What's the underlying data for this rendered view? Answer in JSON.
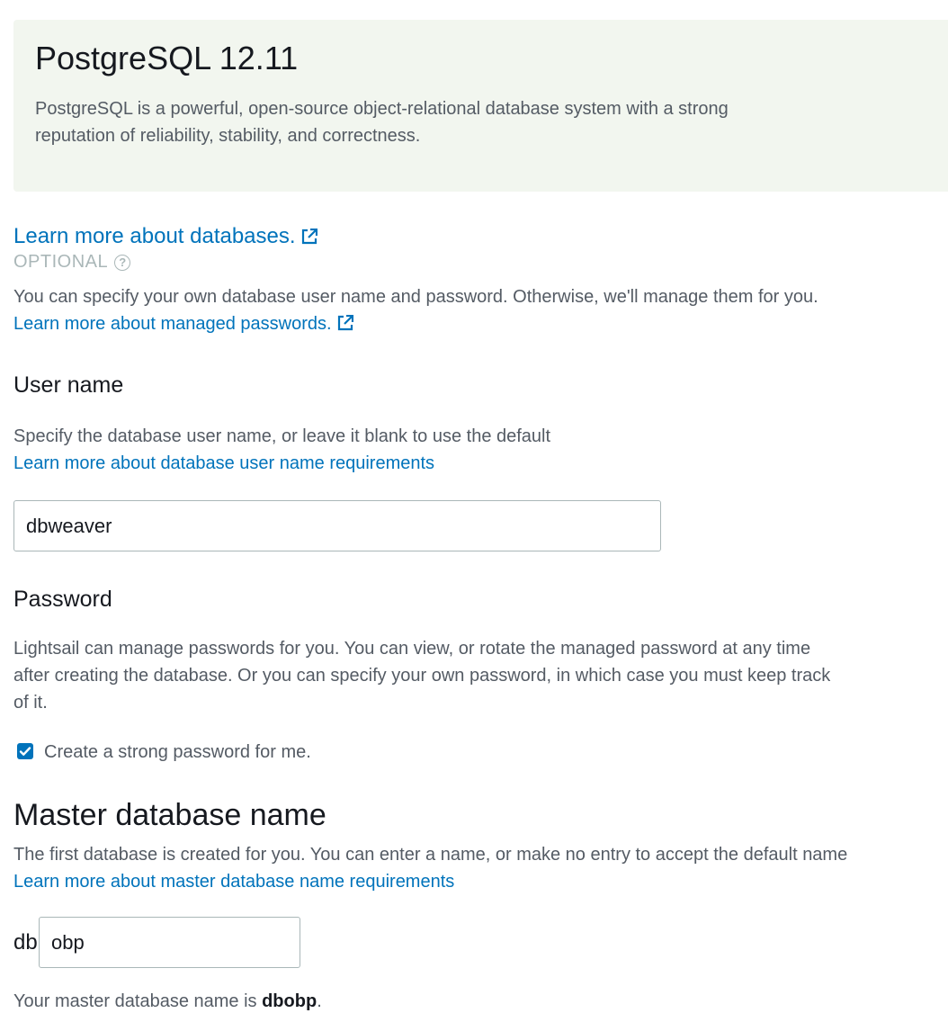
{
  "engine": {
    "title": "PostgreSQL 12.11",
    "description": "PostgreSQL is a powerful, open-source object-relational database system with a strong reputation of reliability, stability, and correctness."
  },
  "learn_more_databases": "Learn more about databases.",
  "optional_label": "OPTIONAL",
  "intro": {
    "text": "You can specify your own database user name and password. Otherwise, we'll manage them for you.",
    "link": "Learn more about managed passwords."
  },
  "user_name": {
    "label": "User name",
    "description": "Specify the database user name, or leave it blank to use the default",
    "link": "Learn more about database user name requirements",
    "value": "dbweaver"
  },
  "password": {
    "label": "Password",
    "description": "Lightsail can manage passwords for you. You can view, or rotate the managed password at any time after creating the database. Or you can specify your own password, in which case you must keep track of it.",
    "checkbox_label": "Create a strong password for me.",
    "checkbox_checked": true
  },
  "master_db": {
    "label": "Master database name",
    "description": "The first database is created for you. You can enter a name, or make no entry to accept the default name",
    "link": "Learn more about master database name requirements",
    "prefix": "db",
    "value": "obp",
    "result_text": "Your master database name is",
    "result_name": "dbobp",
    "result_suffix": "."
  },
  "colors": {
    "link": "#0073bb",
    "card_background": "#f2f6ef",
    "checkbox": "#0073bb"
  },
  "icons": {
    "external_link": "external-link-icon",
    "help": "help-icon",
    "check": "checkmark-icon"
  }
}
